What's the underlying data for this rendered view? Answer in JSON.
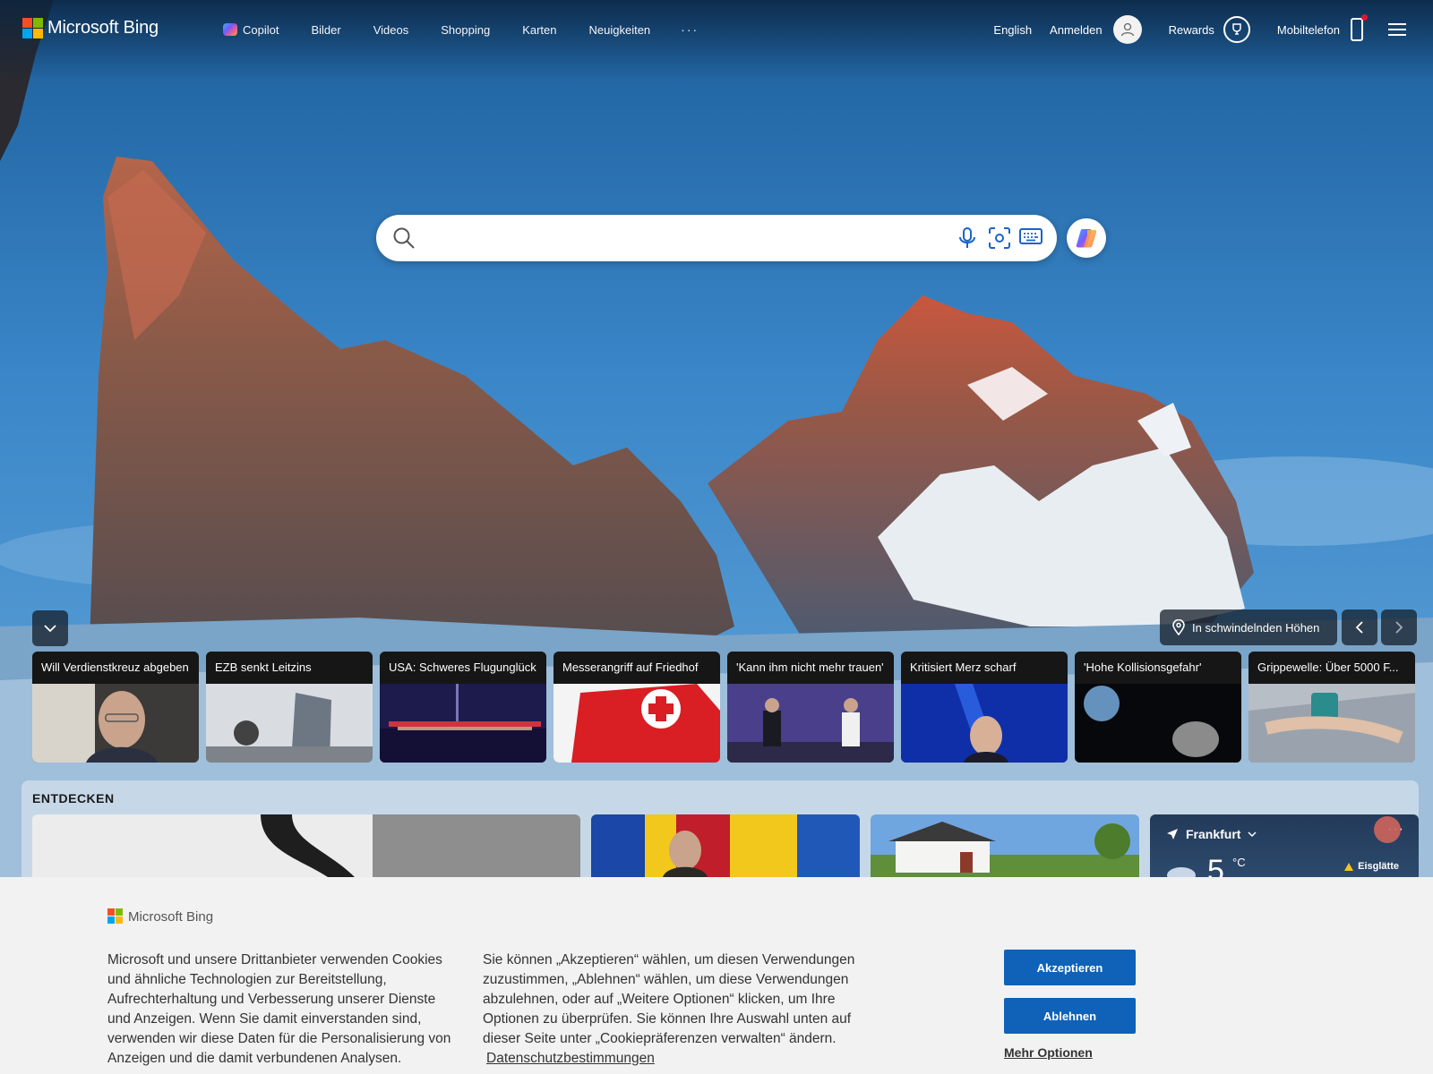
{
  "brand": {
    "name": "Microsoft Bing"
  },
  "nav": {
    "items": [
      "Copilot",
      "Bilder",
      "Videos",
      "Shopping",
      "Karten",
      "Neuigkeiten"
    ],
    "more": "···"
  },
  "header_right": {
    "language": "English",
    "signin": "Anmelden",
    "rewards": "Rewards",
    "mobile": "Mobiltelefon"
  },
  "search": {
    "value": "",
    "placeholder": ""
  },
  "image_info": {
    "location_label": "In schwindelnden Höhen"
  },
  "news": [
    {
      "title": "Will Verdienstkreuz abgeben",
      "icon": "portrait-photo"
    },
    {
      "title": "EZB senkt Leitzins",
      "icon": "ecb-building-photo"
    },
    {
      "title": "USA: Schweres Flugunglück",
      "icon": "night-river-photo"
    },
    {
      "title": "Messerangriff auf Friedhof",
      "icon": "paramedic-photo"
    },
    {
      "title": "'Kann ihm nicht mehr trauen'",
      "icon": "talkshow-photo"
    },
    {
      "title": "Kritisiert Merz scharf",
      "icon": "politician-photo"
    },
    {
      "title": "'Hohe Kollisionsgefahr'",
      "icon": "asteroid-photo"
    },
    {
      "title": "Grippewelle: Über 5000 F...",
      "icon": "sick-person-photo"
    }
  ],
  "discover": {
    "title": "ENTDECKEN",
    "weather": {
      "city": "Frankfurt",
      "temp": "5",
      "unit": "°C",
      "alert": "Eisglätte"
    }
  },
  "cookie": {
    "text1": "Microsoft und unsere Drittanbieter verwenden Cookies und ähnliche Technologien zur Bereitstellung, Aufrechterhaltung und Verbesserung unserer Dienste und Anzeigen. Wenn Sie damit einverstanden sind, verwenden wir diese Daten für die Personalisierung von Anzeigen und die damit verbundenen Analysen.",
    "text2": "Sie können „Akzeptieren“ wählen, um diesen Verwendungen zuzustimmen, „Ablehnen“ wählen, um diese Verwendungen abzulehnen, oder auf „Weitere Optionen“ klicken, um Ihre Optionen zu überprüfen. Sie können Ihre Auswahl unten auf dieser Seite unter „Cookiepräferenzen verwalten“ ändern.",
    "privacy_link": "Datenschutzbestimmungen",
    "accept": "Akzeptieren",
    "reject": "Ablehnen",
    "more": "Mehr Optionen"
  },
  "colors": {
    "accent": "#0f62b8",
    "banner_bg": "#f2f2f2"
  }
}
